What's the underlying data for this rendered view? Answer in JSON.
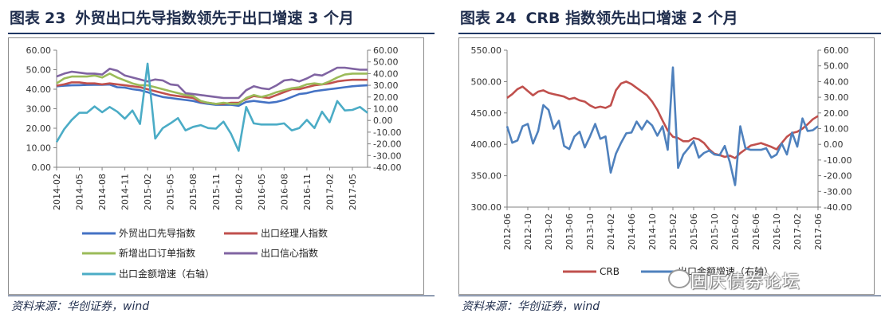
{
  "left": {
    "fig_label": "图表",
    "fig_num": "23",
    "title": "外贸出口先导指数领先于出口增速 3 个月",
    "source": "资料来源：华创证券，wind"
  },
  "right": {
    "fig_label": "图表",
    "fig_num": "24",
    "title": "CRB 指数领先出口增速 2 个月",
    "source": "资料来源：华创证券，wind"
  },
  "watermark": "固庆债券论坛",
  "chart_data": [
    {
      "type": "line",
      "x": [
        "2014-02",
        "2014-03",
        "2014-04",
        "2014-05",
        "2014-06",
        "2014-07",
        "2014-08",
        "2014-09",
        "2014-10",
        "2014-11",
        "2014-12",
        "2015-01",
        "2015-02",
        "2015-03",
        "2015-04",
        "2015-05",
        "2015-06",
        "2015-07",
        "2015-08",
        "2015-09",
        "2015-10",
        "2015-11",
        "2015-12",
        "2016-01",
        "2016-02",
        "2016-03",
        "2016-04",
        "2016-05",
        "2016-06",
        "2016-07",
        "2016-08",
        "2016-09",
        "2016-10",
        "2016-11",
        "2016-12",
        "2017-01",
        "2017-02",
        "2017-03",
        "2017-04",
        "2017-05",
        "2017-06",
        "2017-07"
      ],
      "xticks": [
        "2014-02",
        "2014-05",
        "2014-08",
        "2014-11",
        "2015-02",
        "2015-05",
        "2015-08",
        "2015-11",
        "2016-02",
        "2016-05",
        "2016-08",
        "2016-11",
        "2017-02",
        "2017-05"
      ],
      "ylim_left": [
        0,
        60
      ],
      "yticks_left": [
        "0.00",
        "10.00",
        "20.00",
        "30.00",
        "40.00",
        "50.00",
        "60.00"
      ],
      "ylim_right": [
        -40,
        60
      ],
      "yticks_right": [
        "-40.00",
        "-30.00",
        "-20.00",
        "-10.00",
        "0.00",
        "10.00",
        "20.00",
        "30.00",
        "40.00",
        "50.00",
        "60.00"
      ],
      "legend_position": "bottom",
      "series": [
        {
          "name": "外贸出口先导指数",
          "axis": "left",
          "color": "#4472c4",
          "values": [
            41.5,
            41.8,
            42.0,
            42.1,
            42.2,
            42.3,
            42.3,
            42.4,
            41.0,
            40.8,
            40.0,
            39.5,
            38.5,
            37.0,
            36.0,
            35.5,
            35.0,
            34.5,
            34.0,
            33.0,
            32.5,
            32.0,
            32.0,
            32.0,
            31.5,
            33.5,
            34.0,
            33.5,
            33.0,
            33.5,
            34.5,
            36.0,
            37.5,
            38.0,
            39.0,
            39.5,
            40.0,
            40.5,
            41.0,
            41.5,
            41.8,
            42.0
          ]
        },
        {
          "name": "出口经理人指数",
          "axis": "left",
          "color": "#c0504d",
          "values": [
            41.8,
            42.5,
            43.5,
            43.5,
            43.0,
            43.0,
            42.5,
            43.0,
            42.5,
            42.0,
            41.5,
            41.0,
            40.0,
            39.0,
            38.0,
            37.0,
            36.5,
            36.0,
            35.5,
            33.5,
            33.0,
            32.5,
            32.5,
            33.0,
            33.0,
            35.0,
            36.5,
            36.0,
            35.5,
            37.0,
            38.5,
            40.0,
            40.0,
            41.0,
            42.0,
            42.5,
            43.0,
            44.0,
            44.5,
            44.8,
            44.8,
            44.8
          ]
        },
        {
          "name": "新增出口订单指数",
          "axis": "left",
          "color": "#9bbb59",
          "values": [
            43.0,
            45.5,
            46.5,
            46.5,
            46.5,
            47.0,
            46.0,
            48.0,
            46.0,
            44.5,
            43.0,
            42.0,
            42.0,
            41.0,
            40.0,
            39.0,
            38.0,
            37.0,
            36.5,
            34.0,
            33.0,
            32.5,
            33.0,
            32.5,
            32.5,
            35.5,
            37.0,
            36.0,
            37.0,
            38.5,
            39.5,
            40.5,
            41.0,
            42.5,
            43.0,
            42.5,
            44.0,
            46.0,
            47.5,
            48.0,
            48.0,
            48.0
          ]
        },
        {
          "name": "出口信心指数",
          "axis": "left",
          "color": "#8064a2",
          "values": [
            46.5,
            48.0,
            49.0,
            48.5,
            48.0,
            48.0,
            47.5,
            50.5,
            49.5,
            47.0,
            46.0,
            45.0,
            44.0,
            45.0,
            44.5,
            42.5,
            42.0,
            38.0,
            37.5,
            37.0,
            36.5,
            36.0,
            35.5,
            35.5,
            35.5,
            39.5,
            41.5,
            40.5,
            40.0,
            42.0,
            44.5,
            45.0,
            44.0,
            45.5,
            47.5,
            47.0,
            49.0,
            51.0,
            51.0,
            50.5,
            50.0,
            50.0
          ]
        },
        {
          "name": "出口金额增速（右轴）",
          "axis": "right",
          "color": "#4bacc6",
          "values": [
            -18.5,
            -7.5,
            0.5,
            6.5,
            6.5,
            12.0,
            7.0,
            11.5,
            7.5,
            1.5,
            8.5,
            -3.0,
            48.5,
            -15.5,
            -6.5,
            -2.5,
            2.0,
            -8.5,
            -5.5,
            -4.0,
            -6.5,
            -7.0,
            -1.0,
            -11.5,
            -26.0,
            11.5,
            -2.5,
            -3.5,
            -3.5,
            -3.5,
            -2.5,
            -8.5,
            -6.5,
            0.5,
            -6.5,
            7.5,
            -1.5,
            16.5,
            8.5,
            9.0,
            11.5,
            6.5
          ]
        }
      ]
    },
    {
      "type": "line",
      "x": [
        "2012-06",
        "2012-07",
        "2012-08",
        "2012-09",
        "2012-10",
        "2012-11",
        "2012-12",
        "2013-01",
        "2013-02",
        "2013-03",
        "2013-04",
        "2013-05",
        "2013-06",
        "2013-07",
        "2013-08",
        "2013-09",
        "2013-10",
        "2013-11",
        "2013-12",
        "2014-01",
        "2014-02",
        "2014-03",
        "2014-04",
        "2014-05",
        "2014-06",
        "2014-07",
        "2014-08",
        "2014-09",
        "2014-10",
        "2014-11",
        "2014-12",
        "2015-01",
        "2015-02",
        "2015-03",
        "2015-04",
        "2015-05",
        "2015-06",
        "2015-07",
        "2015-08",
        "2015-09",
        "2015-10",
        "2015-11",
        "2015-12",
        "2016-01",
        "2016-02",
        "2016-03",
        "2016-04",
        "2016-05",
        "2016-06",
        "2016-07",
        "2016-08",
        "2016-09",
        "2016-10",
        "2016-11",
        "2016-12",
        "2017-01",
        "2017-02",
        "2017-03",
        "2017-04",
        "2017-05",
        "2017-06"
      ],
      "xticks": [
        "2012-06",
        "2012-10",
        "2013-02",
        "2013-06",
        "2013-10",
        "2014-02",
        "2014-06",
        "2014-10",
        "2015-02",
        "2015-06",
        "2015-10",
        "2016-02",
        "2016-06",
        "2016-10",
        "2017-02",
        "2017-06"
      ],
      "ylim_left": [
        300,
        550
      ],
      "yticks_left": [
        "300.00",
        "350.00",
        "400.00",
        "450.00",
        "500.00",
        "550.00"
      ],
      "ylim_right": [
        -40,
        60
      ],
      "yticks_right": [
        "-40.00",
        "-30.00",
        "-20.00",
        "-10.00",
        "0.00",
        "10.00",
        "20.00",
        "30.00",
        "40.00",
        "50.00",
        "60.00"
      ],
      "legend_position": "bottom",
      "series": [
        {
          "name": "CRB",
          "axis": "left",
          "color": "#c0504d",
          "values": [
            474,
            480,
            488,
            492,
            485,
            478,
            484,
            486,
            482,
            480,
            478,
            476,
            472,
            474,
            470,
            468,
            462,
            458,
            460,
            458,
            462,
            486,
            497,
            500,
            496,
            490,
            484,
            478,
            468,
            455,
            438,
            422,
            412,
            410,
            405,
            405,
            410,
            408,
            402,
            392,
            385,
            383,
            380,
            382,
            378,
            386,
            392,
            398,
            400,
            402,
            399,
            396,
            392,
            402,
            412,
            418,
            420,
            425,
            432,
            440,
            445
          ]
        },
        {
          "name": "出口金额增速（右轴）",
          "axis": "right",
          "color": "#4f81bd",
          "values": [
            11.5,
            1.0,
            2.5,
            11.5,
            13.0,
            0.5,
            8.5,
            25.0,
            22.0,
            10.0,
            15.0,
            -1.0,
            -3.0,
            5.0,
            8.0,
            -2.0,
            5.0,
            13.0,
            3.5,
            5.0,
            -18.0,
            -6.0,
            1.0,
            7.0,
            7.5,
            14.5,
            9.5,
            15.0,
            12.0,
            5.5,
            11.5,
            -3.5,
            49.0,
            -15.0,
            -6.5,
            -2.5,
            2.0,
            -8.5,
            -5.5,
            -4.0,
            -6.5,
            -7.0,
            -1.0,
            -11.5,
            -26.0,
            11.5,
            -2.5,
            -3.5,
            -3.5,
            -3.5,
            -2.5,
            -8.5,
            -6.5,
            0.5,
            -6.5,
            7.5,
            -1.5,
            16.5,
            8.5,
            9.0,
            11.5
          ]
        }
      ]
    }
  ]
}
